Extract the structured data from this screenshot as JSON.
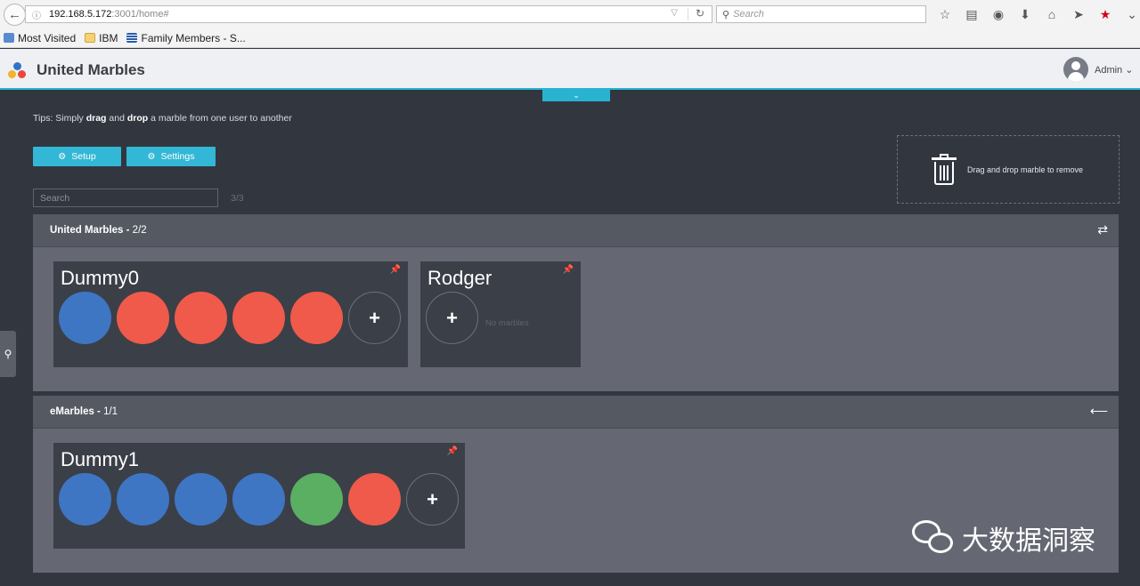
{
  "browser": {
    "url_host": "192.168.5.172",
    "url_path": ":3001/home#",
    "search_placeholder": "Search",
    "bookmarks": [
      {
        "label": "Most Visited",
        "icon": "most-visited-icon"
      },
      {
        "label": "IBM",
        "icon": "folder-icon"
      },
      {
        "label": "Family Members - S...",
        "icon": "ibm-icon"
      }
    ]
  },
  "header": {
    "title": "United Marbles",
    "user_label": "Admin"
  },
  "tips": {
    "prefix": "Tips: Simply ",
    "drag": "drag",
    "and": " and ",
    "drop": "drop",
    "suffix": " a marble from one user to another"
  },
  "toolbar": {
    "setup_label": "Setup",
    "settings_label": "Settings",
    "search_placeholder": "Search",
    "count": "3/3"
  },
  "trash": {
    "label": "Drag and drop marble to remove"
  },
  "companies": [
    {
      "name": "United Marbles",
      "separator": " - ",
      "count": "2/2",
      "users": [
        {
          "name": "Dummy0",
          "marbles": [
            "blue",
            "red",
            "red",
            "red",
            "red"
          ]
        },
        {
          "name": "Rodger",
          "marbles": [],
          "empty_text": "No marbles"
        }
      ]
    },
    {
      "name": "eMarbles",
      "separator": " - ",
      "count": "1/1",
      "users": [
        {
          "name": "Dummy1",
          "marbles": [
            "blue",
            "blue",
            "blue",
            "blue",
            "green",
            "red"
          ]
        }
      ]
    }
  ],
  "colors": {
    "accent": "#33b7d6",
    "marble_blue": "#3e76c3",
    "marble_red": "#f05a4a",
    "marble_green": "#5aaf62"
  },
  "watermark": {
    "text": "大数据洞察"
  }
}
